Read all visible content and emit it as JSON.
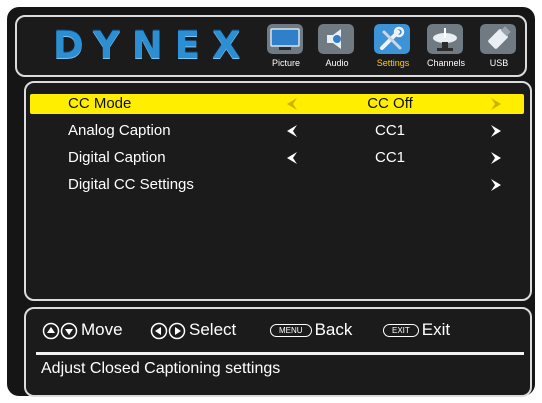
{
  "brand": {
    "logo_text": "DYNEX"
  },
  "tabs": [
    {
      "label": "Picture",
      "icon": "tv-icon",
      "active": false
    },
    {
      "label": "Audio",
      "icon": "speaker-icon",
      "active": false
    },
    {
      "label": "Settings",
      "icon": "tools-icon",
      "active": true
    },
    {
      "label": "Channels",
      "icon": "satellite-dish-icon",
      "active": false
    },
    {
      "label": "USB",
      "icon": "usb-drive-icon",
      "active": false
    }
  ],
  "menu": [
    {
      "label": "CC Mode",
      "value": "CC Off",
      "has_left": true,
      "has_right": true,
      "selected": true
    },
    {
      "label": "Analog Caption",
      "value": "CC1",
      "has_left": true,
      "has_right": true,
      "selected": false
    },
    {
      "label": "Digital Caption",
      "value": "CC1",
      "has_left": true,
      "has_right": true,
      "selected": false
    },
    {
      "label": "Digital CC Settings",
      "value": "",
      "has_left": false,
      "has_right": true,
      "selected": false
    }
  ],
  "help": {
    "move": "Move",
    "select": "Select",
    "menu_key": "MENU",
    "back": "Back",
    "exit_key": "EXIT",
    "exit": "Exit"
  },
  "description": "Adjust Closed Captioning settings",
  "colors": {
    "accent": "#ffee00",
    "active_tab_label": "#ffcc00",
    "logo": "#2c8fd4",
    "background": "#151515"
  }
}
